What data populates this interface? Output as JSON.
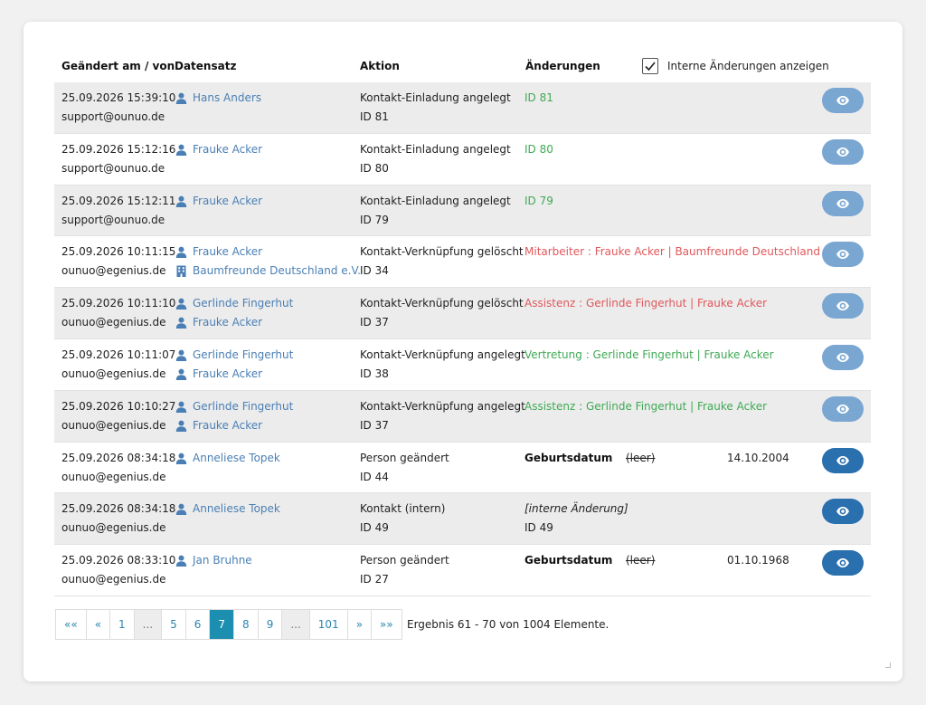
{
  "header": {
    "col_changed": "Geändert am / von",
    "col_record": "Datensatz",
    "col_action": "Aktion",
    "col_changes": "Änderungen",
    "internal_label": "Interne Änderungen anzeigen",
    "internal_checked": true
  },
  "rows": [
    {
      "date": "25.09.2026 15:39:10",
      "user": "support@ounuo.de",
      "records": [
        {
          "type": "person",
          "name": "Hans Anders"
        }
      ],
      "action": "Kontakt-Einladung angelegt",
      "action_id": "ID 81",
      "change": "ID 81",
      "change_color": "green"
    },
    {
      "date": "25.09.2026 15:12:16",
      "user": "support@ounuo.de",
      "records": [
        {
          "type": "person",
          "name": "Frauke Acker"
        }
      ],
      "action": "Kontakt-Einladung angelegt",
      "action_id": "ID 80",
      "change": "ID 80",
      "change_color": "green"
    },
    {
      "date": "25.09.2026 15:12:11",
      "user": "support@ounuo.de",
      "records": [
        {
          "type": "person",
          "name": "Frauke Acker"
        }
      ],
      "action": "Kontakt-Einladung angelegt",
      "action_id": "ID 79",
      "change": "ID 79",
      "change_color": "green"
    },
    {
      "date": "25.09.2026 10:11:15",
      "user": "ounuo@egenius.de",
      "records": [
        {
          "type": "person",
          "name": "Frauke Acker"
        },
        {
          "type": "org",
          "name": "Baumfreunde Deutschland e.V."
        }
      ],
      "action": "Kontakt-Verknüpfung gelöscht",
      "action_id": "ID 34",
      "change": "Mitarbeiter : Frauke Acker | Baumfreunde Deutschland e.V.",
      "change_color": "red"
    },
    {
      "date": "25.09.2026 10:11:10",
      "user": "ounuo@egenius.de",
      "records": [
        {
          "type": "person",
          "name": "Gerlinde Fingerhut"
        },
        {
          "type": "person",
          "name": "Frauke Acker"
        }
      ],
      "action": "Kontakt-Verknüpfung gelöscht",
      "action_id": "ID 37",
      "change": "Assistenz : Gerlinde Fingerhut | Frauke Acker",
      "change_color": "red"
    },
    {
      "date": "25.09.2026 10:11:07",
      "user": "ounuo@egenius.de",
      "records": [
        {
          "type": "person",
          "name": "Gerlinde Fingerhut"
        },
        {
          "type": "person",
          "name": "Frauke Acker"
        }
      ],
      "action": "Kontakt-Verknüpfung angelegt",
      "action_id": "ID 38",
      "change": "Vertretung : Gerlinde Fingerhut | Frauke Acker",
      "change_color": "green"
    },
    {
      "date": "25.09.2026 10:10:27",
      "user": "ounuo@egenius.de",
      "records": [
        {
          "type": "person",
          "name": "Gerlinde Fingerhut"
        },
        {
          "type": "person",
          "name": "Frauke Acker"
        }
      ],
      "action": "Kontakt-Verknüpfung angelegt",
      "action_id": "ID 37",
      "change": "Assistenz : Gerlinde Fingerhut | Frauke Acker",
      "change_color": "green"
    },
    {
      "date": "25.09.2026 08:34:18",
      "user": "ounuo@egenius.de",
      "records": [
        {
          "type": "person",
          "name": "Anneliese Topek"
        }
      ],
      "action": "Person geändert",
      "action_id": "ID 44",
      "diff": {
        "field": "Geburtsdatum",
        "old": "(leer)",
        "new": "14.10.2004"
      },
      "button_dark": true
    },
    {
      "date": "25.09.2026 08:34:18",
      "user": "ounuo@egenius.de",
      "records": [
        {
          "type": "person",
          "name": "Anneliese Topek"
        }
      ],
      "action": "Kontakt (intern)",
      "action_id": "ID 49",
      "internal": {
        "note": "[interne Änderung]",
        "id": "ID 49"
      },
      "button_dark": true
    },
    {
      "date": "25.09.2026 08:33:10",
      "user": "ounuo@egenius.de",
      "records": [
        {
          "type": "person",
          "name": "Jan Bruhne"
        }
      ],
      "action": "Person geändert",
      "action_id": "ID 27",
      "diff": {
        "field": "Geburtsdatum",
        "old": "(leer)",
        "new": "01.10.1968"
      },
      "button_dark": true
    }
  ],
  "pagination": {
    "pages": [
      "««",
      "«",
      "1",
      "...",
      "5",
      "6",
      "7",
      "8",
      "9",
      "...",
      "101",
      "»",
      "»»"
    ],
    "active": "7",
    "info": "Ergebnis 61 - 70 von 1004 Elemente."
  },
  "colors": {
    "accent": "#1c8fb0",
    "link": "#4a7fb5",
    "green": "#3faa55",
    "red": "#e0585c",
    "eye_light": "#7aa7d2",
    "eye_dark": "#2a6fae"
  },
  "icons": {
    "person": "person-icon",
    "org": "building-icon",
    "view": "eye-icon",
    "check": "check-icon"
  }
}
